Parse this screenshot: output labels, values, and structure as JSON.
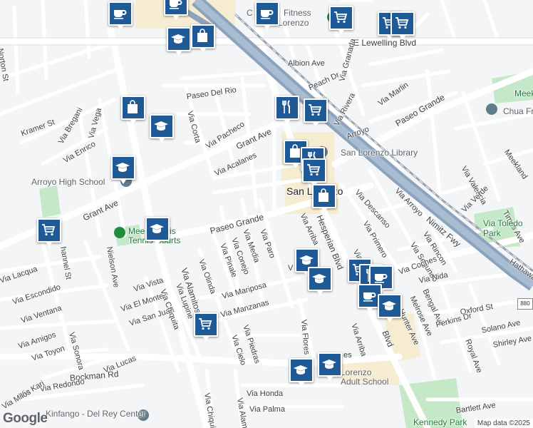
{
  "map": {
    "google_logo": "Google",
    "attribution": "Map data ©2025",
    "colors": {
      "land": "#f4f5f7",
      "road": "#ffffff",
      "freeway": "#8ca3bd",
      "rail": "#9aa4b0",
      "park": "#c5e8c8",
      "commercial": "#f6ecd2",
      "marker": "#1f5a96"
    },
    "place_label": "San Lorenzo",
    "labels": {
      "e_lewelling": "E Lewelling Blvd",
      "albion": "Albion Ave",
      "paseo_del_rio": "Paseo Del Rio",
      "via_granada": "Via Granada",
      "peach_dr": "Peach Dr",
      "via_marlin": "Via Marlin",
      "via_rivera": "Via Rivera",
      "paseo_grande_top": "Paseo Grande",
      "via_arroyo_top": "Arroyo",
      "kramer": "Kramer St",
      "via_bregani": "Via Bregani",
      "via_vega": "Via Vega",
      "via_enrico": "Via Enrico",
      "via_corta": "Via Corta",
      "via_pacheco": "Via Pacheco",
      "grant_ave_top": "Grant Ave",
      "via_acalanes": "Via Acalanes",
      "arroyo_high": "Arroyo High School",
      "grant_ave_left": "Grant Ave",
      "library": "San Lorenzo Library",
      "via_descanso": "Via Descanso",
      "via_arroyo": "Via Arroyo",
      "via_valencia": "Via Valencia",
      "via_verde": "Via Verde",
      "nimitz": "Nimitz Fwy",
      "times_ave": "Times Ave",
      "meekland": "Meekland",
      "meek": "Meek",
      "chua": "Chua Fr",
      "hathaway": "Hathawa",
      "via_toledo_park": "Via Toledo\nPark",
      "meek_morris": "Meek-Morris\nTennis Courts",
      "paseo_grande": "Paseo Grande",
      "via_arriba": "Via Arriba",
      "hesperian": "Hesperian Blvd",
      "via_primero": "Via Primero",
      "via_rincon": "Via Rincon",
      "via_segundo": "Via Segundo",
      "via_andeta": "Via Andeta",
      "via_coches": "Via Coches",
      "via_nida": "Via Nida",
      "bengal": "Bengal Ave",
      "melrose": "Melrose Ave",
      "hunter": "Hunter Ave",
      "oxford": "Oxford St",
      "perkins": "Perkins Dr",
      "solano": "Solano Ave",
      "shirley": "Shirley Ave",
      "royal": "Royal Ave",
      "nielson": "Nielson Ave",
      "via_vista": "Via Vista",
      "via_el_monte": "Via El Monte",
      "via_san_juan": "Via San Juan",
      "via_escondido": "Via Escondido",
      "via_ventana": "Via Ventana",
      "via_amigos": "Via Amigos",
      "via_toyon": "Via Toyon",
      "via_lacqua": "Via Lacqua",
      "channel": "hannel St",
      "via_lucas": "Via Lucas",
      "via_sonora": "Via Sonora",
      "via_chiquita": "Via Chiquita",
      "via_lupine": "Via Lupine",
      "via_alamitos": "Via Alamitos",
      "via_olinda": "Via Olinda",
      "via_pinale": "Via Pinale",
      "via_conejo": "Via Conejo",
      "via_media": "Via Media",
      "via_paro": "Via Paro",
      "via_mariposa": "Via Mariposa",
      "via_manzanas": "Via Manzanas",
      "via_piedras": "Via Piedras",
      "via_cielo": "Via Cielo",
      "via_flores": "Via Flores",
      "via_arriba_bottom": "Via Arriba",
      "via_v": "V",
      "blvd": "Blvd",
      "bockman": "Bockman Rd",
      "via_redondo": "Via Redondo",
      "via_kari": "Via Kari",
      "via_milos": "Via Milos",
      "via_honda": "Via Honda",
      "via_palma": "Via Palma",
      "via_alamitos_bottom": "Via Alamito",
      "via_chiquita_bottom": "Via Chiqui",
      "kennedy_park": "Kennedy Park",
      "bartlett": "Bartlett Ave",
      "kindergo": "Kinfango - Del Rey Center",
      "adult_school": "Lorenzo\nAdult School",
      "adult_school_es": "es",
      "norton": "Norton St",
      "fitness": "Fitness",
      "lorenzo_top": "Lorenzo",
      "mission": "C"
    },
    "freeway_shield": "880",
    "markers": [
      {
        "type": "cafe"
      },
      {
        "type": "cafe"
      },
      {
        "type": "cafe"
      },
      {
        "type": "grocery"
      },
      {
        "type": "grocery"
      },
      {
        "type": "grocery"
      },
      {
        "type": "school"
      },
      {
        "type": "shopping"
      },
      {
        "type": "shopping"
      },
      {
        "type": "school"
      },
      {
        "type": "restaurant"
      },
      {
        "type": "grocery"
      },
      {
        "type": "shopping"
      },
      {
        "type": "restaurant"
      },
      {
        "type": "grocery"
      },
      {
        "type": "school"
      },
      {
        "type": "shopping"
      },
      {
        "type": "grocery"
      },
      {
        "type": "school"
      },
      {
        "type": "school"
      },
      {
        "type": "school"
      },
      {
        "type": "grocery"
      },
      {
        "type": "restaurant"
      },
      {
        "type": "cafe"
      },
      {
        "type": "cafe"
      },
      {
        "type": "school"
      },
      {
        "type": "grocery"
      },
      {
        "type": "school"
      },
      {
        "type": "school"
      }
    ]
  }
}
